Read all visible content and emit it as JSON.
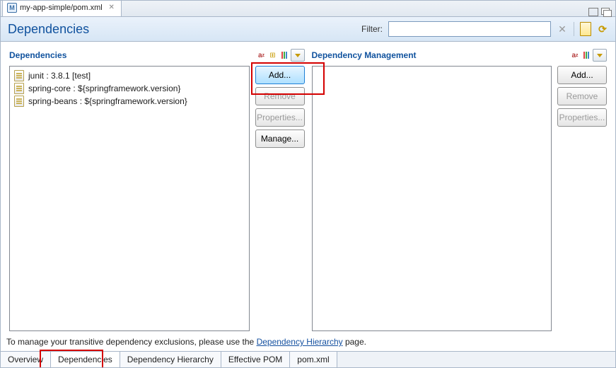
{
  "tab": {
    "title": "my-app-simple/pom.xml"
  },
  "header": {
    "title": "Dependencies",
    "filter_label": "Filter:",
    "filter_value": ""
  },
  "panels": {
    "left": {
      "title": "Dependencies",
      "items": [
        "junit : 3.8.1 [test]",
        "spring-core : ${springframework.version}",
        "spring-beans : ${springframework.version}"
      ],
      "buttons": {
        "add": "Add...",
        "remove": "Remove",
        "properties": "Properties...",
        "manage": "Manage..."
      }
    },
    "right": {
      "title": "Dependency Management",
      "buttons": {
        "add": "Add...",
        "remove": "Remove",
        "properties": "Properties..."
      }
    }
  },
  "hint": {
    "prefix": "To manage your transitive dependency exclusions, please use the ",
    "link": "Dependency Hierarchy",
    "suffix": " page."
  },
  "bottom_tabs": [
    "Overview",
    "Dependencies",
    "Dependency Hierarchy",
    "Effective POM",
    "pom.xml"
  ]
}
